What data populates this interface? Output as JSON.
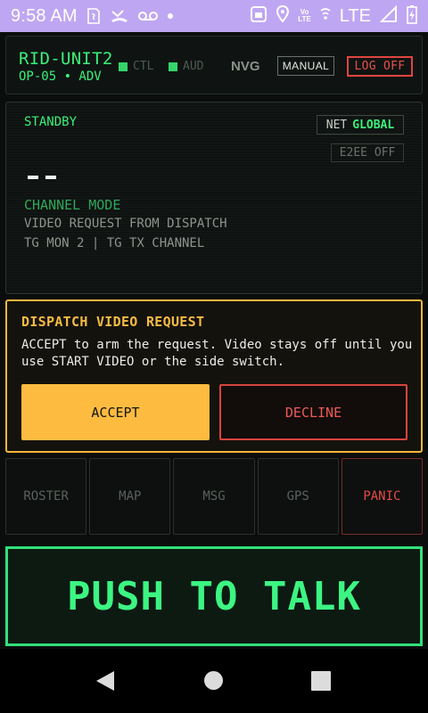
{
  "status_bar": {
    "time": "9:58 AM",
    "network": "LTE",
    "volte_top": "Vo",
    "volte_bottom": "LTE",
    "bg_color": "#bfa6f2"
  },
  "header": {
    "unit_name": "RID-UNIT2",
    "unit_sub": "OP-05 • ADV",
    "indicators": [
      {
        "label": "CTL",
        "color": "#34d56a"
      },
      {
        "label": "AUD",
        "color": "#34d56a"
      }
    ],
    "nvg_label": "NVG",
    "manual_label": "MANUAL",
    "logoff_label": "LOG OFF"
  },
  "panel": {
    "state": "STANDBY",
    "net_key": "NET",
    "net_value": "GLOBAL",
    "e2ee_label": "E2EE OFF",
    "channel_mode": "CHANNEL MODE",
    "line1": "VIDEO REQUEST FROM DISPATCH",
    "line2": "TG MON 2 | TG TX CHANNEL"
  },
  "dispatch": {
    "title": "DISPATCH VIDEO REQUEST",
    "body": "ACCEPT to arm the request. Video stays off until you use START VIDEO or the side switch.",
    "accept_label": "ACCEPT",
    "decline_label": "DECLINE",
    "accent_color": "#f4b73c"
  },
  "quick_buttons": [
    {
      "label": "ROSTER"
    },
    {
      "label": "MAP"
    },
    {
      "label": "MSG"
    },
    {
      "label": "GPS"
    },
    {
      "label": "PANIC"
    }
  ],
  "ptt_label": "PUSH TO TALK",
  "colors": {
    "accent_green": "#3cf07a",
    "danger_red": "#e0453f"
  }
}
